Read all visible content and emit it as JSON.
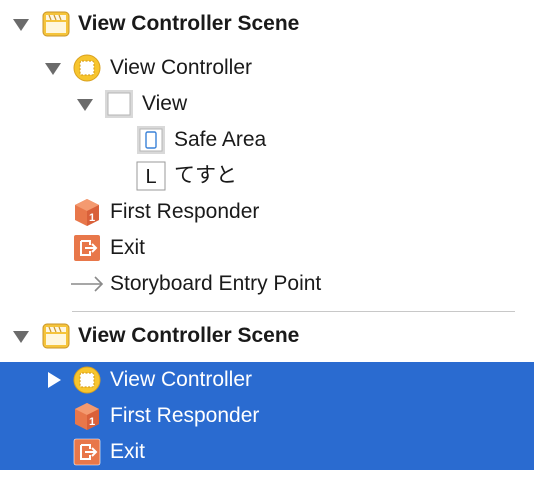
{
  "outline": {
    "rows": [
      {
        "label": "View Controller Scene",
        "icon": "scene-icon",
        "disclosure": "expanded",
        "selected": false
      },
      {
        "label": "View Controller",
        "icon": "view-controller-icon",
        "disclosure": "expanded",
        "selected": false
      },
      {
        "label": "View",
        "icon": "view-icon",
        "disclosure": "expanded",
        "selected": false
      },
      {
        "label": "Safe Area",
        "icon": "safe-area-icon",
        "disclosure": "none",
        "selected": false
      },
      {
        "label": "てすと",
        "icon": "label-icon",
        "disclosure": "none",
        "selected": false
      },
      {
        "label": "First Responder",
        "icon": "first-responder-icon",
        "disclosure": "none",
        "selected": false
      },
      {
        "label": "Exit",
        "icon": "exit-icon",
        "disclosure": "none",
        "selected": false
      },
      {
        "label": "Storyboard Entry Point",
        "icon": "entry-point-arrow-icon",
        "disclosure": "none",
        "selected": false
      },
      {
        "label": "View Controller Scene",
        "icon": "scene-icon",
        "disclosure": "expanded",
        "selected": false
      },
      {
        "label": "View Controller",
        "icon": "view-controller-icon",
        "disclosure": "collapsed",
        "selected": true
      },
      {
        "label": "First Responder",
        "icon": "first-responder-icon",
        "disclosure": "none",
        "selected": true
      },
      {
        "label": "Exit",
        "icon": "exit-icon",
        "disclosure": "none",
        "selected": true
      }
    ],
    "label_icon_glyph": "L"
  },
  "colors": {
    "selection": "#2a6bd0",
    "scene_icon": "#f5c43b",
    "view_controller_icon": "#f7c52e",
    "first_responder_icon": "#e8774a",
    "exit_icon": "#e8774a",
    "disclosure": "#6b6b6b"
  }
}
